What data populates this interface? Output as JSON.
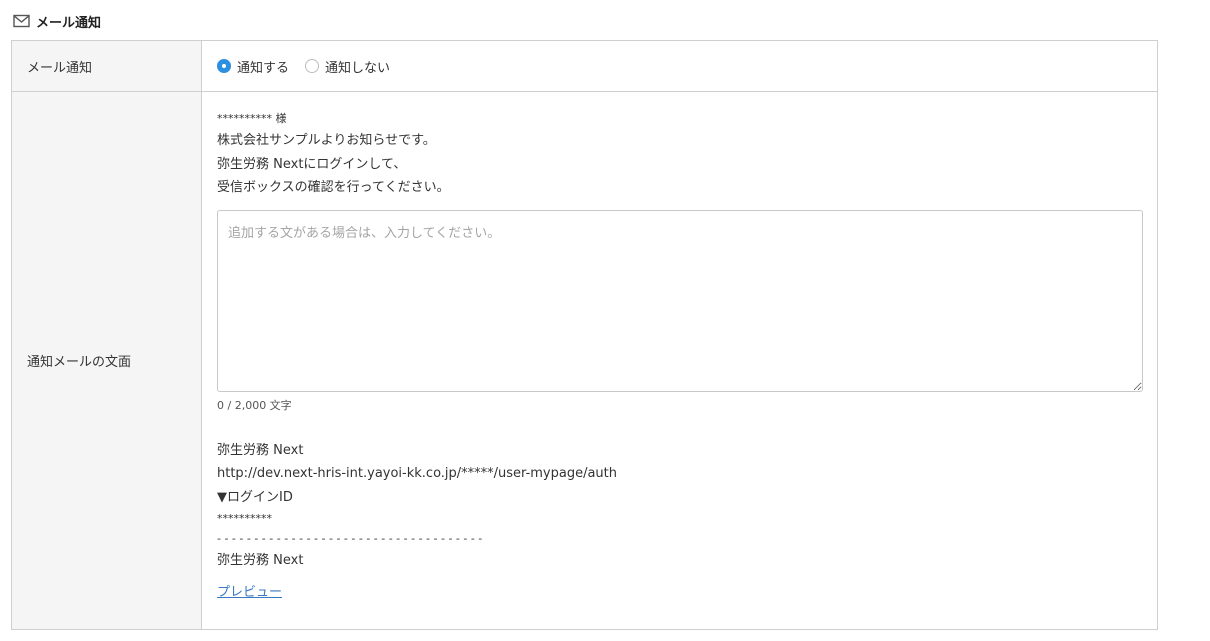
{
  "section": {
    "icon": "mail-icon",
    "title": "メール通知"
  },
  "notify_row": {
    "label": "メール通知",
    "options": [
      {
        "label": "通知する",
        "selected": true
      },
      {
        "label": "通知しない",
        "selected": false
      }
    ],
    "accent_color": "#2d8fe0"
  },
  "body_row": {
    "label": "通知メールの文面",
    "greeting_lines": [
      "********** 様",
      "株式会社サンプルよりお知らせです。",
      "弥生労務 Nextにログインして、",
      "受信ボックスの確認を行ってください。"
    ],
    "textarea": {
      "placeholder": "追加する文がある場合は、入力してください。",
      "value": ""
    },
    "counter": "0 / 2,000 文字",
    "footer_lines": [
      "弥生労務 Next",
      "http://dev.next-hris-int.yayoi-kk.co.jp/*****/user-mypage/auth",
      "▼ログインID",
      "**********",
      "- - - - - - - - - - - - - - - - - - - - - - - - - - - - - - - - - - - -",
      "弥生労務 Next"
    ],
    "preview_link": "プレビュー"
  }
}
